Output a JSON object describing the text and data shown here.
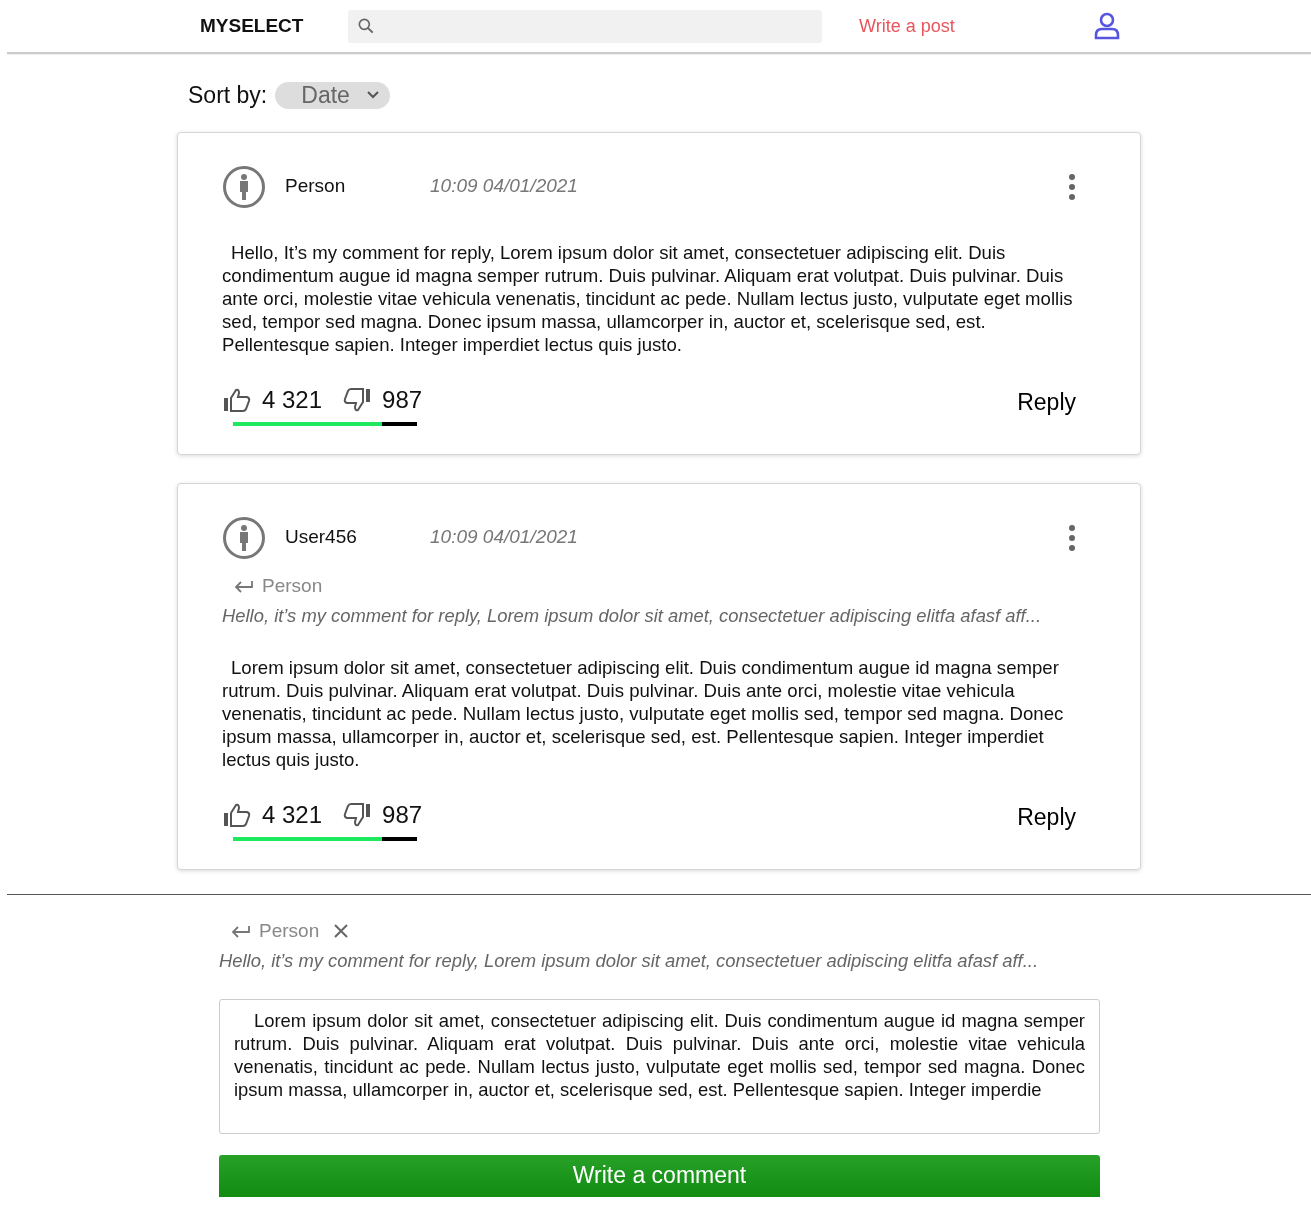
{
  "header": {
    "brand": "MYSELECT",
    "write_post": "Write a post"
  },
  "sort": {
    "label": "Sort by:",
    "value": "Date"
  },
  "comments": [
    {
      "author": "Person",
      "time": "10:09  04/01/2021",
      "text": "Hello, It’s my comment for reply, Lorem ipsum dolor sit amet, consectetuer adipiscing elit. Duis condimentum augue id magna semper rutrum. Duis pulvinar. Aliquam erat volutpat. Duis pulvinar. Duis ante orci, molestie vitae vehicula venenatis, tincidunt ac pede. Nullam lectus justo, vulputate eget mollis sed, tempor sed magna. Donec ipsum massa, ullamcorper in, auctor et, scelerisque sed, est. Pellentesque sapien. Integer imperdiet lectus quis justo.",
      "likes": "4 321",
      "dislikes": "987",
      "level": 0.81,
      "reply": "Reply"
    },
    {
      "author": "User456",
      "time": "10:09  04/01/2021",
      "reply_to": {
        "author": "Person",
        "quote": "Hello, it’s my comment for reply,  Lorem ipsum dolor sit amet, consectetuer adipiscing elitfa afasf aff..."
      },
      "text": "Lorem ipsum dolor sit amet, consectetuer adipiscing elit. Duis condimentum augue id magna semper rutrum. Duis pulvinar. Aliquam erat volutpat. Duis pulvinar. Duis ante orci, molestie vitae vehicula venenatis, tincidunt ac pede. Nullam lectus justo, vulputate eget mollis sed, tempor sed magna. Donec ipsum massa, ullamcorper in, auctor et, scelerisque sed, est. Pellentesque sapien. Integer imperdiet lectus quis justo.",
      "likes": "4 321",
      "dislikes": "987",
      "level": 0.81,
      "reply": "Reply"
    }
  ],
  "compose": {
    "reply_to": {
      "author": "Person",
      "quote": "Hello, it’s my comment for reply,  Lorem ipsum dolor sit amet, consectetuer adipiscing elitfa afasf aff..."
    },
    "value": "Lorem ipsum dolor sit amet, consectetuer adipiscing elit. Duis condimentum augue id magna semper rutrum. Duis pulvinar. Aliquam erat volutpat. Duis pulvinar. Duis ante orci, molestie vitae vehicula venenatis, tincidunt ac pede. Nullam lectus justo, vulputate eget mollis sed, tempor sed magna. Donec ipsum massa, ullamcorper in, auctor et, scelerisque sed, est. Pellentesque sapien. Integer imperdie",
    "button": "Write a comment"
  }
}
